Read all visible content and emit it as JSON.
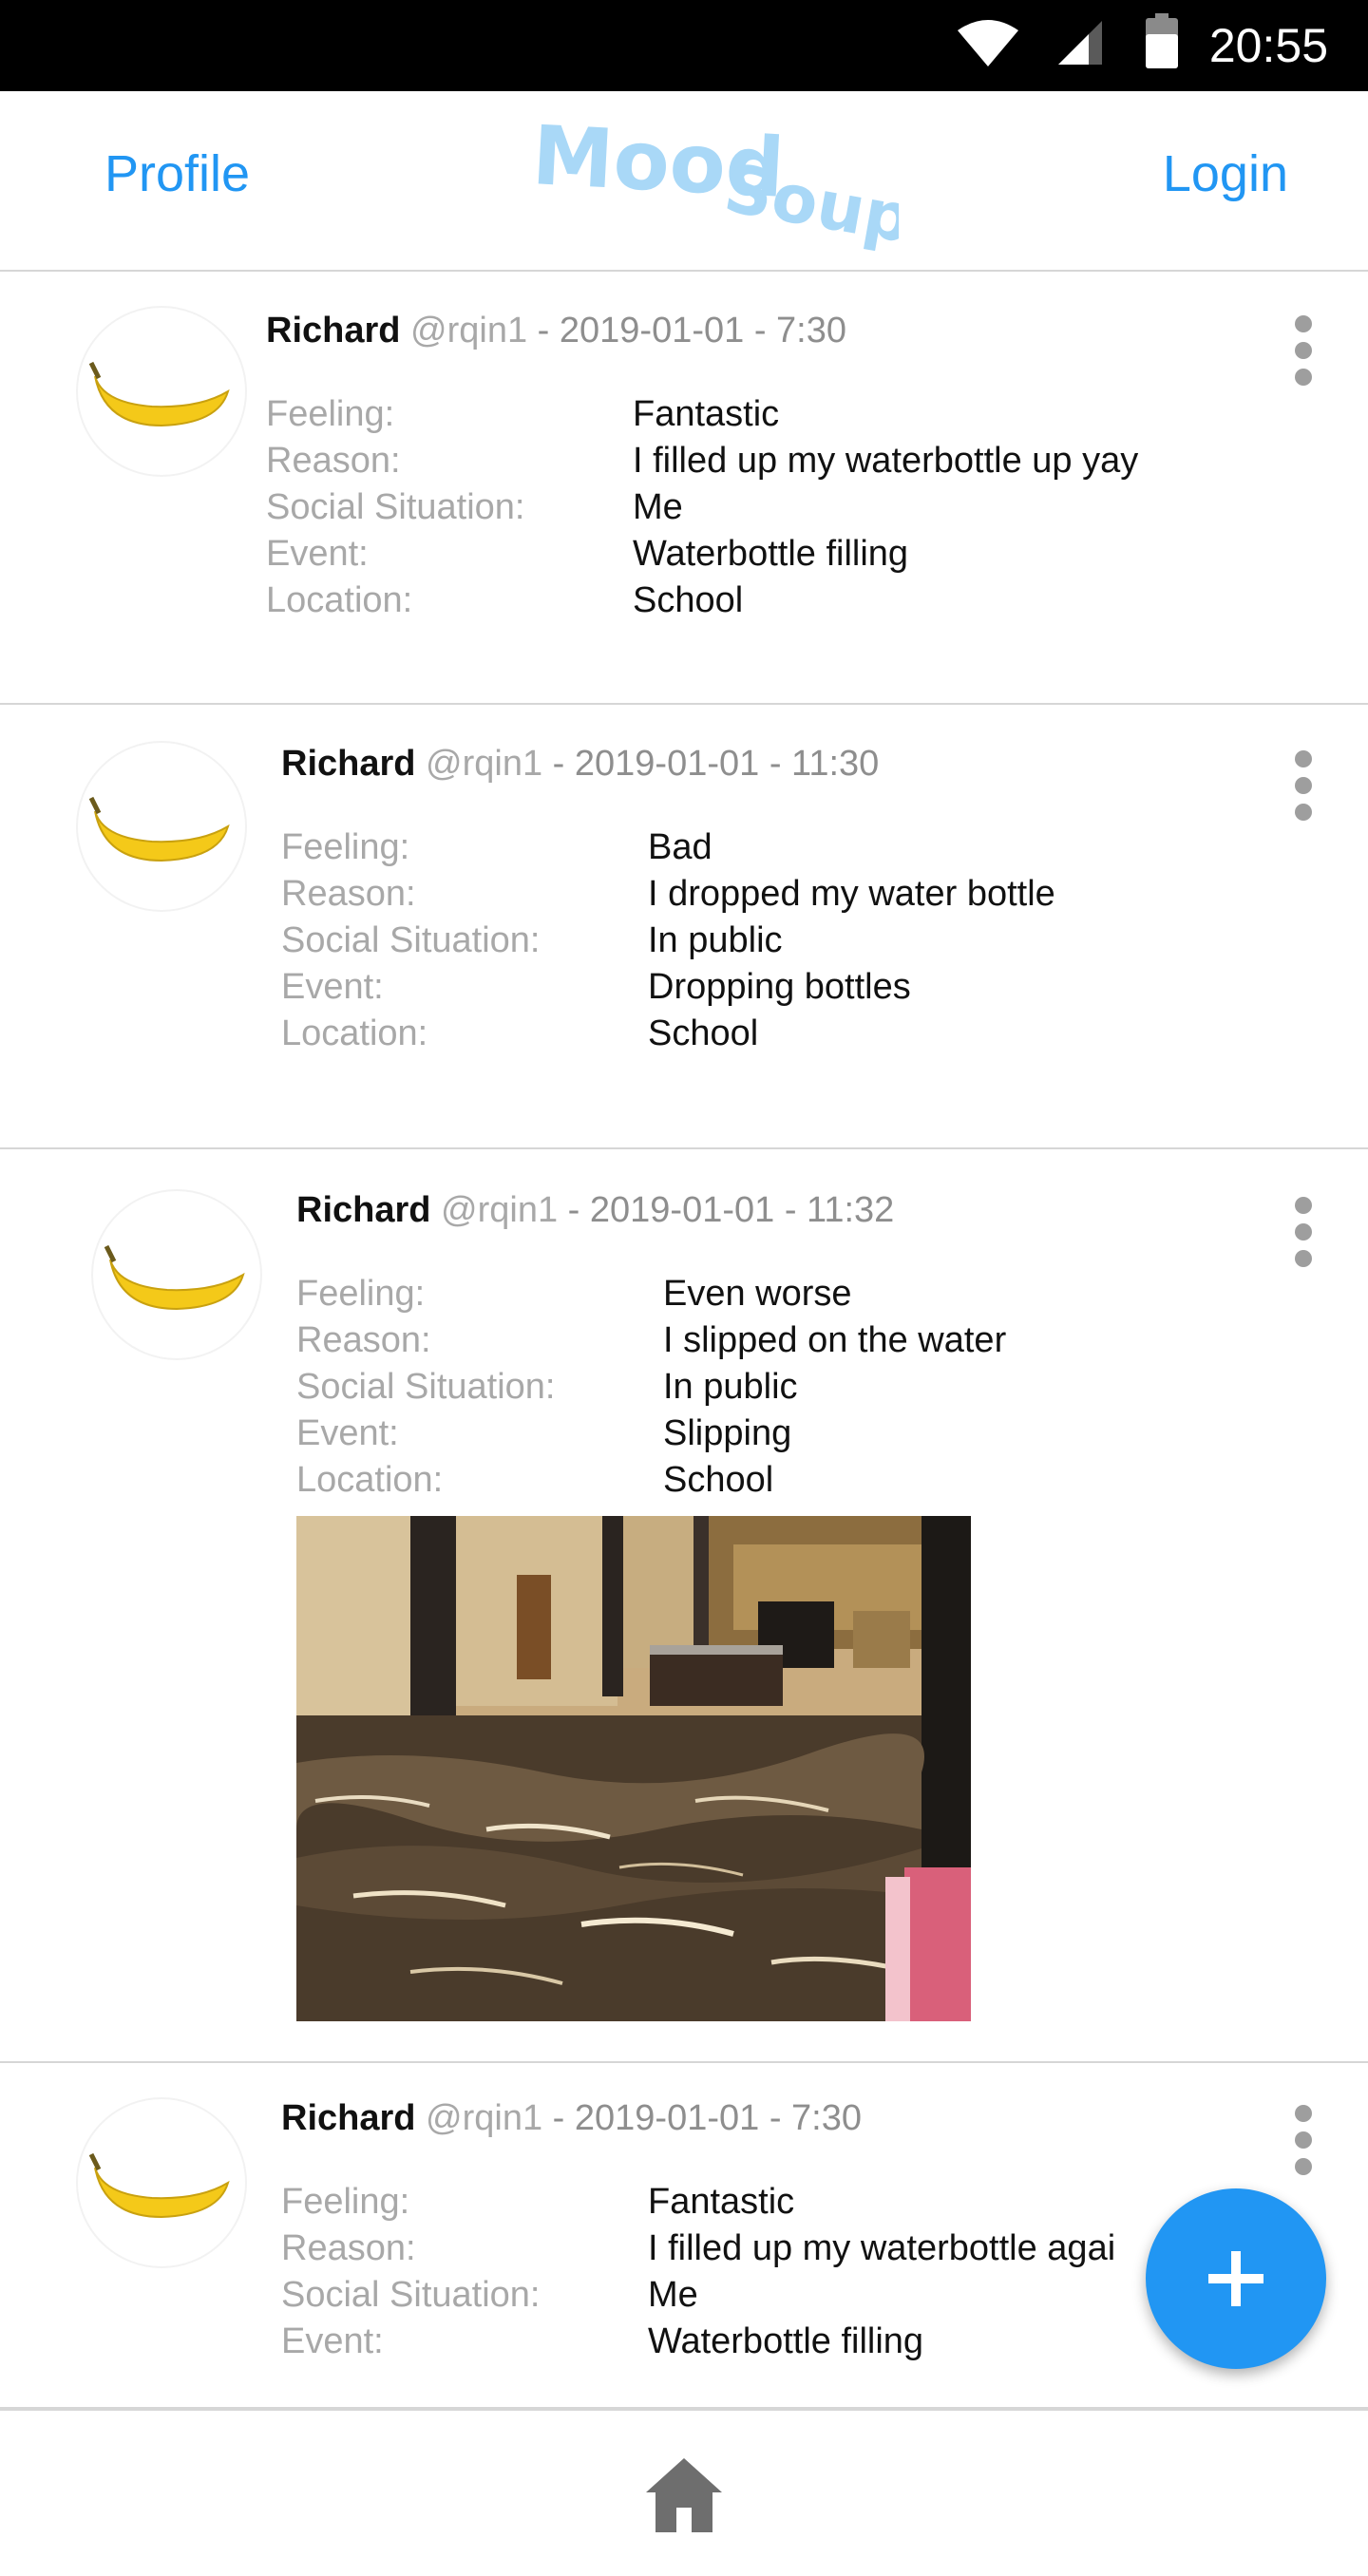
{
  "status_bar": {
    "time": "20:55",
    "icons": [
      "wifi-icon",
      "cell-signal-icon",
      "battery-icon"
    ]
  },
  "header": {
    "profile_label": "Profile",
    "logo_text": "MoodSoup",
    "login_label": "Login"
  },
  "colors": {
    "accent": "#2196f3",
    "logo": "#a9d8f7",
    "label_gray": "#a8a8a8",
    "divider": "#d6d6d6"
  },
  "field_labels": {
    "feeling": "Feeling:",
    "reason": "Reason:",
    "social": "Social Situation:",
    "event": "Event:",
    "location": "Location:"
  },
  "posts": [
    {
      "name": "Richard",
      "handle": "@rqin1",
      "meta": " - 2019-01-01 - 7:30",
      "avatar_icon": "banana-icon",
      "feeling": "Fantastic",
      "reason": "I filled up my waterbottle up yay",
      "social": "Me",
      "event": "Waterbottle filling",
      "location": "School"
    },
    {
      "name": "Richard",
      "handle": "@rqin1",
      "meta": " - 2019-01-01 - 11:30",
      "avatar_icon": "banana-icon",
      "feeling": "Bad",
      "reason": "I dropped my water bottle",
      "social": "In public",
      "event": "Dropping bottles",
      "location": "School"
    },
    {
      "name": "Richard",
      "handle": "@rqin1",
      "meta": " - 2019-01-01 - 11:32",
      "avatar_icon": "banana-icon",
      "feeling": "Even worse",
      "reason": "I slipped on the water",
      "social": "In public",
      "event": "Slipping",
      "location": "School",
      "photo": "flooded-lobby-photo"
    },
    {
      "name": "Richard",
      "handle": "@rqin1",
      "meta": " - 2019-01-01 - 7:30",
      "avatar_icon": "banana-icon",
      "feeling": "Fantastic",
      "reason": "I filled up my waterbottle agai",
      "social": "Me",
      "event": "Waterbottle filling"
    }
  ],
  "fab": {
    "icon": "plus-icon"
  },
  "bottom_nav": {
    "icon": "home-icon"
  }
}
